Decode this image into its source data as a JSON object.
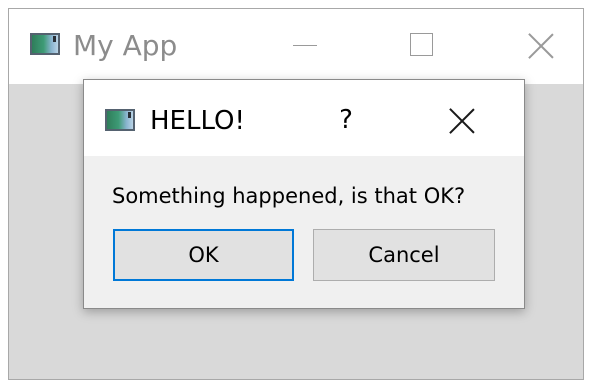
{
  "main_window": {
    "title": "My App",
    "icon": "app-window-icon",
    "controls": {
      "minimize_icon": "minimize-icon",
      "maximize_icon": "maximize-icon",
      "close_icon": "close-icon"
    }
  },
  "dialog": {
    "title": "HELLO!",
    "icon": "app-window-icon",
    "help_label": "?",
    "close_icon": "close-icon",
    "message": "Something happened, is that OK?",
    "buttons": {
      "ok_label": "OK",
      "cancel_label": "Cancel"
    },
    "default_button": "OK"
  },
  "colors": {
    "focus_border": "#0078d7",
    "button_face": "#e1e1e1",
    "client_area": "#d9d9d9"
  }
}
